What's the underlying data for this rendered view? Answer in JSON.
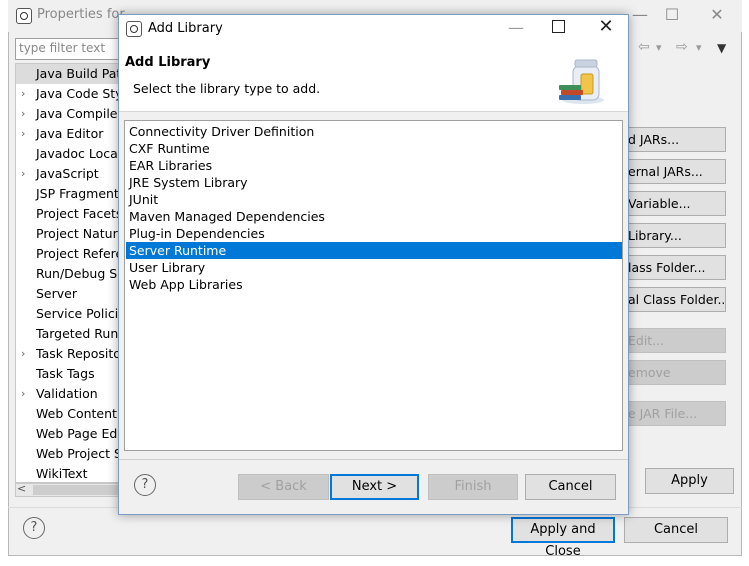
{
  "properties_window": {
    "title": "Properties for",
    "minimize_glyph": "—",
    "maximize_glyph": "☐",
    "close_glyph": "✕",
    "filter_placeholder": "type filter text",
    "nav": {
      "back": "⇦",
      "back_menu": "▾",
      "forward": "⇨",
      "forward_menu": "▾",
      "view_menu": "▼"
    },
    "tree_items": [
      {
        "label": "Java Build Path",
        "expandable": false,
        "selected": true
      },
      {
        "label": "Java Code Style",
        "expandable": true
      },
      {
        "label": "Java Compiler",
        "expandable": true
      },
      {
        "label": "Java Editor",
        "expandable": true
      },
      {
        "label": "Javadoc Location",
        "expandable": false
      },
      {
        "label": "JavaScript",
        "expandable": true
      },
      {
        "label": "JSP Fragment",
        "expandable": false
      },
      {
        "label": "Project Facets",
        "expandable": false
      },
      {
        "label": "Project Natures",
        "expandable": false
      },
      {
        "label": "Project References",
        "expandable": false
      },
      {
        "label": "Run/Debug Settings",
        "expandable": false
      },
      {
        "label": "Server",
        "expandable": false
      },
      {
        "label": "Service Policies",
        "expandable": false
      },
      {
        "label": "Targeted Runtimes",
        "expandable": false
      },
      {
        "label": "Task Repository",
        "expandable": true
      },
      {
        "label": "Task Tags",
        "expandable": false
      },
      {
        "label": "Validation",
        "expandable": true
      },
      {
        "label": "Web Content Settings",
        "expandable": false
      },
      {
        "label": "Web Page Editor",
        "expandable": false
      },
      {
        "label": "Web Project Settings",
        "expandable": false
      },
      {
        "label": "WikiText",
        "expandable": false
      }
    ],
    "side_buttons": [
      {
        "label": "Add JARs...",
        "visible": "d JARs...",
        "enabled": true
      },
      {
        "label": "Add External JARs...",
        "visible": "ernal JARs...",
        "enabled": true
      },
      {
        "label": "Add Variable...",
        "visible": "Variable...",
        "enabled": true
      },
      {
        "label": "Add Library...",
        "visible": "Library...",
        "enabled": true
      },
      {
        "label": "Add Class Folder...",
        "visible": "lass Folder...",
        "enabled": true
      },
      {
        "label": "Add External Class Folder...",
        "visible": "al Class Folder...",
        "enabled": true
      },
      {
        "label": "Edit...",
        "visible": "Edit...",
        "enabled": false
      },
      {
        "label": "Remove",
        "visible": "emove",
        "enabled": false
      },
      {
        "label": "Migrate JAR File...",
        "visible": "e JAR File...",
        "enabled": false
      }
    ],
    "apply_label": "Apply",
    "apply_close_label": "Apply and Close",
    "cancel_label": "Cancel",
    "help_glyph": "?"
  },
  "dialog": {
    "title": "Add Library",
    "heading": "Add Library",
    "description": "Select the library type to add.",
    "min_glyph": "—",
    "close_glyph": "✕",
    "libraries": [
      "Connectivity Driver Definition",
      "CXF Runtime",
      "EAR Libraries",
      "JRE System Library",
      "JUnit",
      "Maven Managed Dependencies",
      "Plug-in Dependencies",
      "Server Runtime",
      "User Library",
      "Web App Libraries"
    ],
    "selected_library": "Server Runtime",
    "buttons": {
      "back": "< Back",
      "next": "Next >",
      "finish": "Finish",
      "cancel": "Cancel"
    },
    "help_glyph": "?",
    "accent_color": "#0078d7"
  }
}
